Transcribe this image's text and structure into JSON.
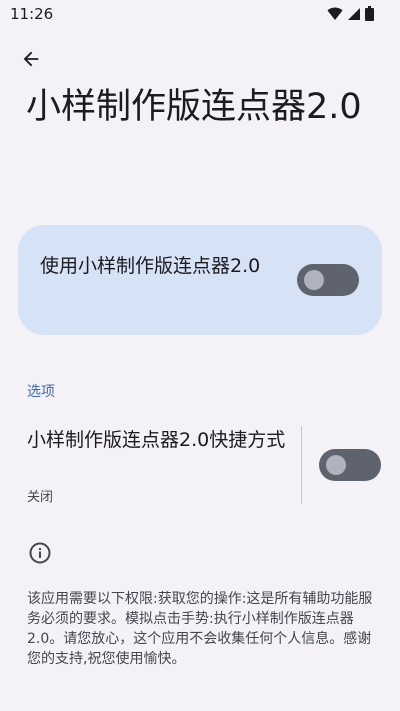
{
  "status_bar": {
    "time": "11:26",
    "icons": [
      "wifi-icon",
      "signal-icon",
      "battery-icon"
    ]
  },
  "header": {
    "back_icon": "arrow-left-icon",
    "title": "小样制作版连点器2.0"
  },
  "main_switch": {
    "label": "使用小样制作版连点器2.0",
    "state": "off"
  },
  "options": {
    "section_title": "选项",
    "shortcut": {
      "title": "小样制作版连点器2.0快捷方式",
      "summary": "关闭",
      "state": "off"
    }
  },
  "info": {
    "icon": "info-icon",
    "text": "该应用需要以下权限:获取您的操作:这是所有辅助功能服务必须的要求。模拟点击手势:执行小样制作版连点器2.0。请您放心，这个应用不会收集任何个人信息。感谢您的支持,祝您使用愉快。"
  },
  "colors": {
    "background": "#f4f1f7",
    "card": "#d6e3f7",
    "accent": "#3f6aa4",
    "switch_track_off": "#5e636d"
  }
}
